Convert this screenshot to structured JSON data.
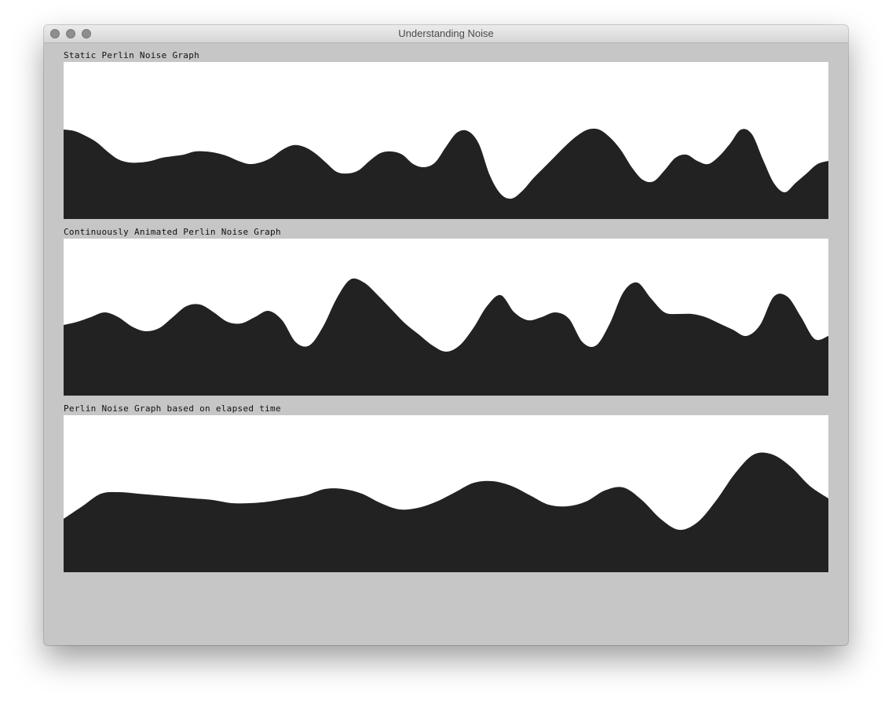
{
  "window": {
    "title": "Understanding Noise"
  },
  "graphs": [
    {
      "label": "Static Perlin Noise Graph",
      "fill_color": "#222222",
      "background_color": "#ffffff",
      "profile": [
        0.57,
        0.56,
        0.53,
        0.49,
        0.43,
        0.38,
        0.36,
        0.36,
        0.37,
        0.39,
        0.4,
        0.41,
        0.43,
        0.43,
        0.42,
        0.4,
        0.37,
        0.35,
        0.36,
        0.39,
        0.44,
        0.47,
        0.46,
        0.42,
        0.36,
        0.3,
        0.29,
        0.31,
        0.37,
        0.42,
        0.43,
        0.41,
        0.35,
        0.33,
        0.36,
        0.46,
        0.55,
        0.56,
        0.48,
        0.28,
        0.16,
        0.13,
        0.18,
        0.26,
        0.33,
        0.4,
        0.47,
        0.53,
        0.57,
        0.57,
        0.52,
        0.44,
        0.33,
        0.25,
        0.24,
        0.31,
        0.39,
        0.41,
        0.37,
        0.35,
        0.4,
        0.48,
        0.57,
        0.54,
        0.38,
        0.23,
        0.17,
        0.23,
        0.29,
        0.35,
        0.37
      ]
    },
    {
      "label": "Continuously Animated Perlin Noise Graph",
      "fill_color": "#222222",
      "background_color": "#ffffff",
      "profile": [
        0.45,
        0.47,
        0.5,
        0.53,
        0.5,
        0.44,
        0.41,
        0.43,
        0.5,
        0.57,
        0.58,
        0.53,
        0.47,
        0.46,
        0.5,
        0.54,
        0.48,
        0.34,
        0.32,
        0.44,
        0.62,
        0.74,
        0.72,
        0.64,
        0.55,
        0.46,
        0.39,
        0.32,
        0.28,
        0.32,
        0.43,
        0.57,
        0.64,
        0.53,
        0.48,
        0.5,
        0.53,
        0.49,
        0.34,
        0.32,
        0.46,
        0.66,
        0.72,
        0.62,
        0.53,
        0.52,
        0.52,
        0.5,
        0.46,
        0.42,
        0.38,
        0.45,
        0.63,
        0.63,
        0.5,
        0.36,
        0.38
      ]
    },
    {
      "label": "Perlin Noise Graph based on elapsed time",
      "fill_color": "#222222",
      "background_color": "#ffffff",
      "profile": [
        0.34,
        0.42,
        0.5,
        0.51,
        0.5,
        0.49,
        0.48,
        0.47,
        0.46,
        0.44,
        0.44,
        0.45,
        0.47,
        0.49,
        0.53,
        0.53,
        0.5,
        0.44,
        0.4,
        0.41,
        0.45,
        0.51,
        0.57,
        0.58,
        0.55,
        0.49,
        0.43,
        0.42,
        0.45,
        0.52,
        0.54,
        0.46,
        0.34,
        0.27,
        0.32,
        0.46,
        0.63,
        0.75,
        0.75,
        0.67,
        0.55,
        0.47
      ]
    }
  ]
}
